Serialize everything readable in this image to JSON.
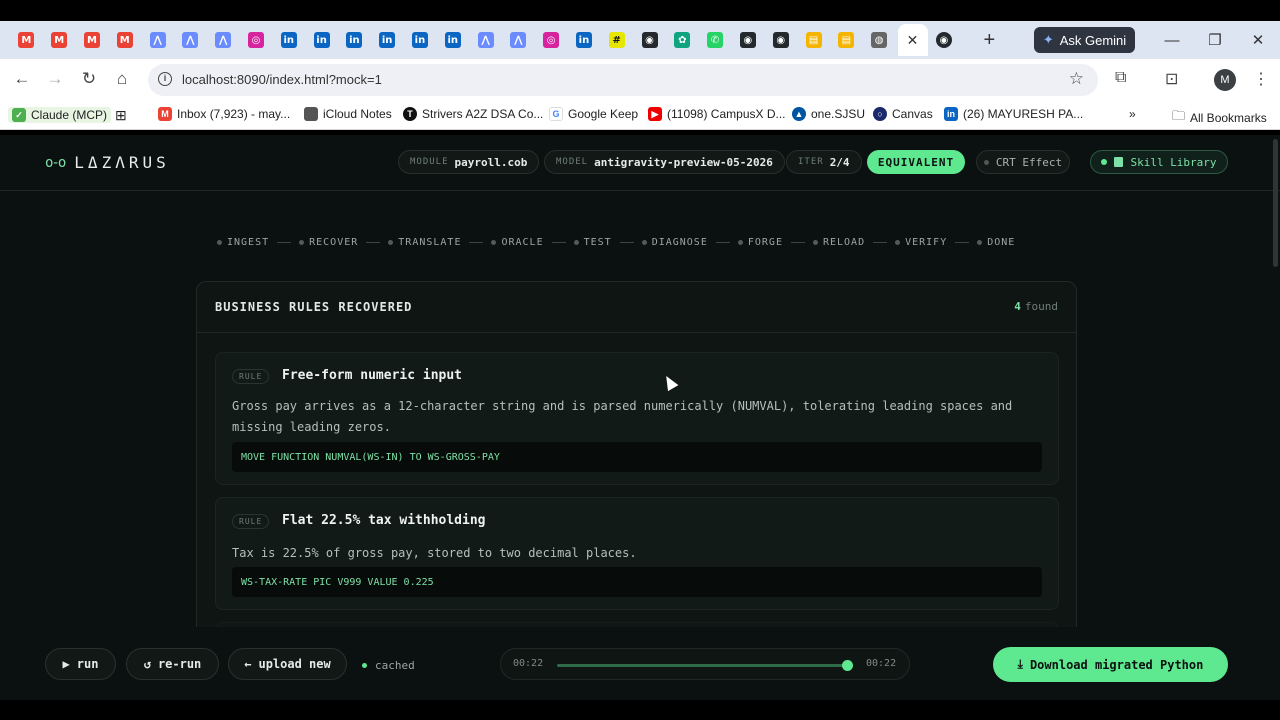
{
  "browser": {
    "tabs_favicons": [
      "gmail-icon",
      "gmail-icon",
      "gmail-icon",
      "gmail-icon",
      "arc-icon",
      "arc-icon",
      "arc-icon",
      "stack-icon",
      "linkedin-icon",
      "linkedin-icon",
      "linkedin-icon",
      "linkedin-icon",
      "linkedin-icon",
      "linkedin-icon",
      "arc-icon",
      "arc-icon",
      "stack-icon",
      "linkedin-icon",
      "hashnode-icon",
      "github-icon",
      "chatgpt-icon",
      "whatsapp-icon",
      "github-icon",
      "github-icon",
      "slides-icon",
      "slides-icon",
      "globe-icon"
    ],
    "active_tab_favicon": "github-icon",
    "ask_gemini": "Ask Gemini",
    "url": "localhost:8090/index.html?mock=1",
    "profile_initial": "M",
    "bookmarks": [
      {
        "label": "Claude (MCP)",
        "icon": "check-icon"
      },
      {
        "label": "Inbox (7,923) - may...",
        "icon": "gmail-icon"
      },
      {
        "label": "iCloud Notes",
        "icon": "apple-icon"
      },
      {
        "label": "Strivers A2Z DSA Co...",
        "icon": "tuf-icon"
      },
      {
        "label": "Google Keep",
        "icon": "google-icon"
      },
      {
        "label": "(11098) CampusX D...",
        "icon": "youtube-icon"
      },
      {
        "label": "one.SJSU",
        "icon": "sjsu-icon"
      },
      {
        "label": "Canvas",
        "icon": "canvas-icon"
      },
      {
        "label": "(26) MAYURESH PA...",
        "icon": "linkedin-icon"
      }
    ],
    "all_bookmarks": "All Bookmarks"
  },
  "app": {
    "logo_text": "LΔZΛRUS",
    "module_key": "MODULE",
    "module_value": "payroll.cob",
    "model_key": "MODEL",
    "model_value": "antigravity-preview-05-2026",
    "iter_key": "ITER",
    "iter_value": "2/4",
    "status": "EQUIVALENT",
    "crt_label": "CRT Effect",
    "skill_label": "Skill Library",
    "steps": [
      "INGEST",
      "RECOVER",
      "TRANSLATE",
      "ORACLE",
      "TEST",
      "DIAGNOSE",
      "FORGE",
      "RELOAD",
      "VERIFY",
      "DONE"
    ],
    "panel": {
      "title": "BUSINESS RULES RECOVERED",
      "count": "4",
      "count_suffix": "found",
      "rules": [
        {
          "tag": "RULE",
          "title": "Free-form numeric input",
          "desc": "Gross pay arrives as a 12-character string and is parsed numerically (NUMVAL), tolerating leading spaces and missing leading zeros.",
          "code": "MOVE FUNCTION NUMVAL(WS-IN) TO WS-GROSS-PAY"
        },
        {
          "tag": "RULE",
          "title": "Flat 22.5% tax withholding",
          "desc": "Tax is 22.5% of gross pay, stored to two decimal places.",
          "code": "WS-TAX-RATE PIC V999 VALUE 0.225"
        }
      ]
    },
    "controls": {
      "run": "run",
      "rerun": "re-run",
      "upload": "upload new",
      "cached": "cached",
      "time_start": "00:22",
      "time_end": "00:22",
      "progress": 1.0,
      "download": "Download migrated Python"
    }
  }
}
